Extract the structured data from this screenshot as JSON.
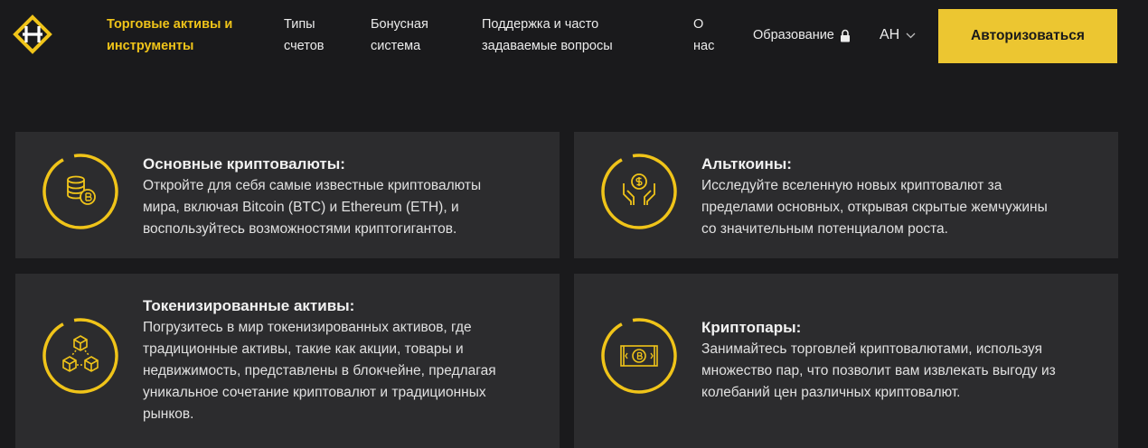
{
  "header": {
    "logo_icon": "diamond-logo-icon",
    "nav": [
      {
        "lines": [
          "Торговые активы и",
          "инструменты"
        ],
        "active": true
      },
      {
        "lines": [
          "Типы",
          "счетов"
        ],
        "active": false
      },
      {
        "lines": [
          "Бонусная",
          "система"
        ],
        "active": false
      },
      {
        "lines": [
          "Поддержка и часто",
          "задаваемые вопросы"
        ],
        "active": false
      },
      {
        "lines": [
          "О",
          "нас"
        ],
        "active": false
      }
    ],
    "education_label": "Образование",
    "education_icon": "lock-icon",
    "language": "АН",
    "language_icon": "chevron-down-icon",
    "login_label": "Авторизоваться"
  },
  "colors": {
    "accent": "#f0c419",
    "button": "#ecc631",
    "background": "#1a1a1c",
    "card": "#2c2c2e"
  },
  "cards": [
    {
      "icon": "coins-bitcoin-icon",
      "title": "Основные криптовалюты:",
      "desc": [
        "Откройте для себя самые известные криптовалюты",
        "мира, включая Bitcoin (BTC) и Ethereum (ETH), и",
        "воспользуйтесь возможностями криптогигантов."
      ]
    },
    {
      "icon": "hands-dollar-icon",
      "title": "Альткоины:",
      "desc": [
        "Исследуйте вселенную новых криптовалют за",
        "пределами основных, открывая скрытые жемчужины",
        "со значительным потенциалом роста."
      ]
    },
    {
      "icon": "blockchain-cubes-icon",
      "title": "Токенизированные активы:",
      "desc": [
        "Погрузитесь в мир токенизированных активов, где",
        "традиционные активы, такие как акции, товары и",
        "недвижимость, представлены в блокчейне, предлагая",
        "уникальное сочетание криптовалют и традиционных",
        "рынков."
      ]
    },
    {
      "icon": "bitcoin-banknote-icon",
      "title": "Криптопары:",
      "desc": [
        "Занимайтесь торговлей криптовалютами, используя",
        "множество пар, что позволит вам извлекать выгоду из",
        "колебаний цен различных криптовалют."
      ]
    }
  ]
}
